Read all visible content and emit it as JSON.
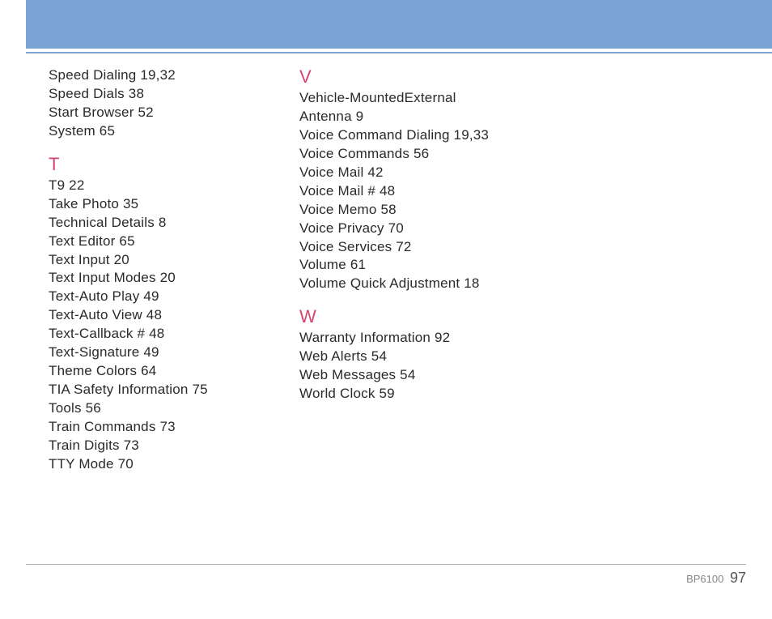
{
  "columns": [
    {
      "sections": [
        {
          "letter": null,
          "entries": [
            "Speed Dialing 19,32",
            "Speed Dials 38",
            "Start Browser 52",
            "System 65"
          ]
        },
        {
          "letter": "T",
          "entries": [
            "T9 22",
            "Take Photo 35",
            "Technical Details 8",
            "Text Editor 65",
            "Text Input 20",
            "Text Input Modes 20",
            "Text-Auto Play 49",
            "Text-Auto View 48",
            "Text-Callback # 48",
            "Text-Signature 49",
            "Theme Colors 64",
            "TIA Safety Information 75",
            "Tools 56",
            "Train Commands 73",
            "Train Digits 73",
            "TTY Mode 70"
          ]
        }
      ]
    },
    {
      "sections": [
        {
          "letter": "V",
          "entries": [
            "Vehicle-MountedExternal Antenna 9",
            "Voice Command Dialing 19,33",
            "Voice Commands 56",
            "Voice Mail 42",
            "Voice Mail # 48",
            "Voice Memo 58",
            "Voice Privacy 70",
            "Voice Services 72",
            "Volume 61",
            "Volume Quick Adjustment 18"
          ]
        },
        {
          "letter": "W",
          "entries": [
            "Warranty Information 92",
            "Web Alerts 54",
            "Web Messages 54",
            "World Clock 59"
          ]
        }
      ]
    }
  ],
  "footer": {
    "model": "BP6100",
    "page": "97"
  }
}
